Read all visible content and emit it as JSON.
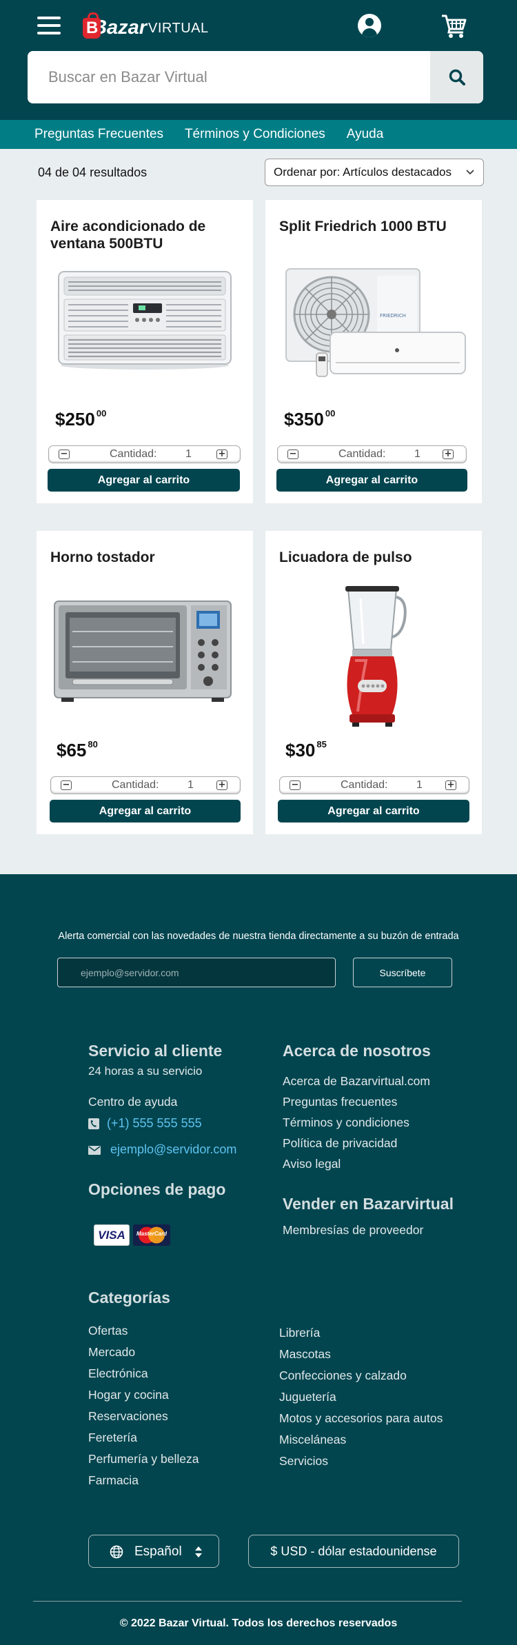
{
  "header": {
    "logo_main": "Bazar",
    "logo_sub": "VIRTUAL",
    "search_placeholder": "Buscar en Bazar Virtual"
  },
  "subnav": [
    "Preguntas Frecuentes",
    "Términos y Condiciones",
    "Ayuda"
  ],
  "toolbar": {
    "results": "04 de 04 resultados",
    "sort_label": "Ordenar por: Artículos destacados"
  },
  "products": [
    {
      "name": "Aire acondicionado de ventana 500BTU",
      "price_int": "$250",
      "price_dec": "00",
      "qty_label": "Cantidad:",
      "qty": "1",
      "add_label": "Agregar al carrito"
    },
    {
      "name": "Split Friedrich 1000 BTU",
      "price_int": "$350",
      "price_dec": "00",
      "qty_label": "Cantidad:",
      "qty": "1",
      "add_label": "Agregar al carrito",
      "brand_text": "FRIEDRICH"
    },
    {
      "name": "Horno tostador",
      "price_int": "$65",
      "price_dec": "80",
      "qty_label": "Cantidad:",
      "qty": "1",
      "add_label": "Agregar al carrito"
    },
    {
      "name": "Licuadora de pulso",
      "price_int": "$30",
      "price_dec": "85",
      "qty_label": "Cantidad:",
      "qty": "1",
      "add_label": "Agregar al carrito"
    }
  ],
  "footer": {
    "alert_text": "Alerta comercial con las novedades de nuestra tienda directamente a su buzón de entrada",
    "email_placeholder": "ejemplo@servidor.com",
    "subscribe": "Suscríbete",
    "service": {
      "title": "Servicio al cliente",
      "hours": "24 horas a su servicio",
      "help": "Centro de ayuda",
      "phone": "(+1) 555 555 555",
      "email": "ejemplo@servidor.com"
    },
    "about": {
      "title": "Acerca de nosotros",
      "links": [
        "Acerca de Bazarvirtual.com",
        "Preguntas frecuentes",
        "Términos y condiciones",
        "Política de privacidad",
        "Aviso legal"
      ]
    },
    "payment": {
      "title": "Opciones de pago",
      "visa": "VISA",
      "mastercard": "MasterCard"
    },
    "sell": {
      "title": "Vender en Bazarvirtual",
      "link": "Membresías de proveedor"
    },
    "categories": {
      "title": "Categorías",
      "left": [
        "Ofertas",
        "Mercado",
        "Electrónica",
        "Hogar y cocina",
        "Reservaciones",
        "Feretería",
        "Perfumería y belleza",
        "Farmacia"
      ],
      "right": [
        "Librería",
        "Mascotas",
        "Confecciones y calzado",
        "Juguetería",
        "Motos y accesorios para autos",
        "Misceláneas",
        "Servicios"
      ]
    },
    "language": "Español",
    "currency": "$  USD - dólar estadounidense",
    "copyright": "© 2022  Bazar Virtual. Todos los derechos reservados"
  },
  "colors": {
    "primary": "#02454f",
    "subnav": "#017d86",
    "page_bg": "#e9eef0",
    "link_blue": "#5ec3ef",
    "logo_red": "#e0262f"
  },
  "icons": [
    "menu-icon",
    "user-icon",
    "cart-icon",
    "search-icon",
    "chevron-down-icon",
    "phone-icon",
    "mail-icon",
    "globe-icon",
    "updown-icon"
  ]
}
